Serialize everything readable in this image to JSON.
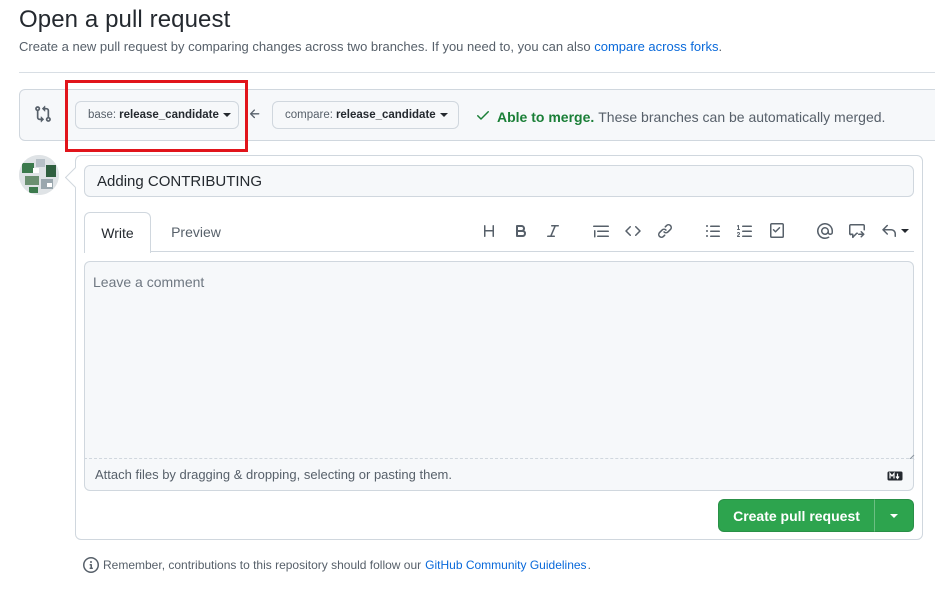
{
  "header": {
    "title": "Open a pull request",
    "subtitle_text": "Create a new pull request by comparing changes across two branches. If you need to, you can also",
    "subtitle_link": "compare across forks",
    "subtitle_end": "."
  },
  "range": {
    "base_prefix": "base:",
    "base_branch": "release_candidate",
    "compare_prefix": "compare:",
    "compare_branch": "release_candidate",
    "merge_ok": "Able to merge.",
    "merge_detail": "These branches can be automatically merged.",
    "status_color": "#1a7f37"
  },
  "composer": {
    "title_value": "Adding CONTRIBUTING",
    "tabs": [
      "Write",
      "Preview"
    ],
    "toolbar_icons": [
      "heading-icon",
      "bold-icon",
      "italic-icon",
      "quote-icon",
      "code-icon",
      "link-icon",
      "unordered-list-icon",
      "ordered-list-icon",
      "task-list-icon",
      "mention-icon",
      "reference-icon",
      "reply-icon"
    ],
    "comment_placeholder": "Leave a comment",
    "attach_text": "Attach files by dragging & dropping, selecting or pasting them.",
    "submit_label": "Create pull request",
    "submit_color": "#2da44e"
  },
  "footer": {
    "text": "Remember, contributions to this repository should follow our",
    "link": "GitHub Community Guidelines",
    "end": "."
  }
}
